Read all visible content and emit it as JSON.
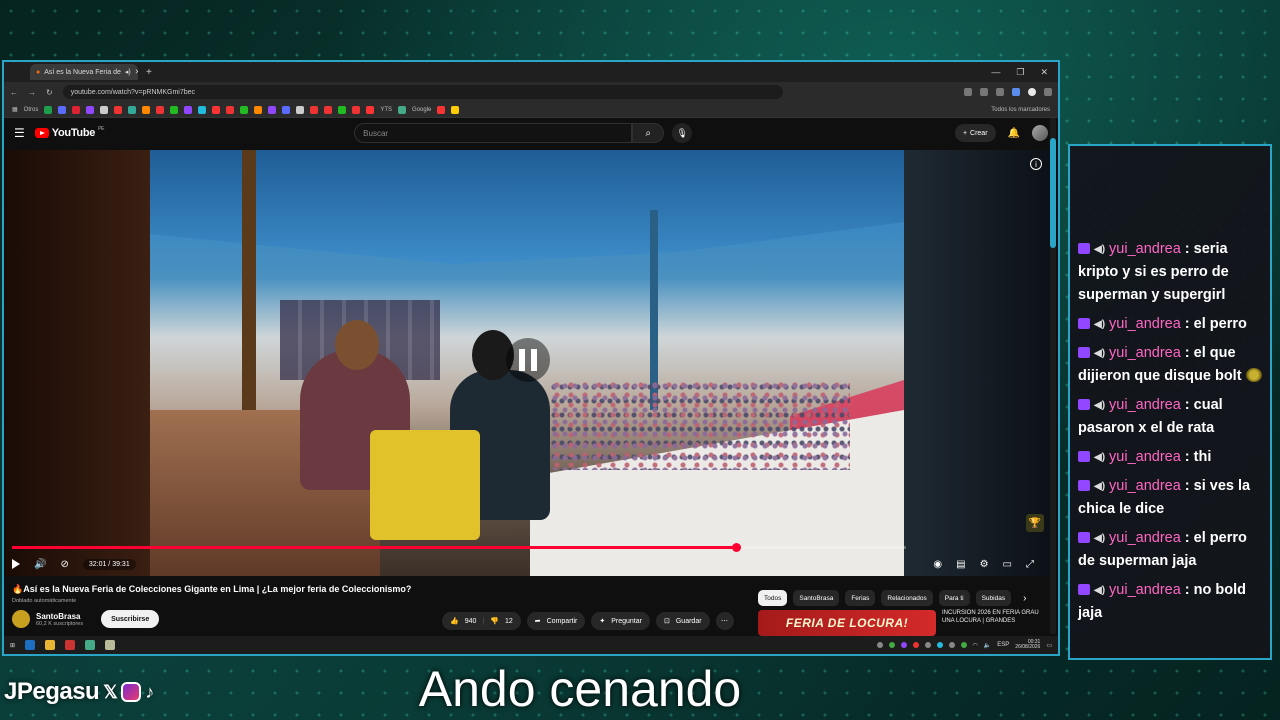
{
  "browser": {
    "tab_title": "Así es la Nueva Feria de",
    "url": "youtube.com/watch?v=pRNMKGmi7bec",
    "bookmarks": {
      "others": "Otros",
      "yts": "YTS",
      "google": "Google",
      "all": "Todos los marcadores"
    }
  },
  "youtube": {
    "logo": "YouTube",
    "region": "PE",
    "search_placeholder": "Buscar",
    "create_label": "Crear"
  },
  "player": {
    "time": "32:01 / 39:31",
    "progress_fraction": 0.81
  },
  "video": {
    "title": "🔥Así es la Nueva Feria de Colecciones Gigante en Lima | ¿La mejor feria de Coleccionismo?",
    "dubbed": "Doblado automáticamente",
    "channel": "SantoBrasa",
    "subscribers": "60,2 K suscriptores",
    "subscribe_label": "Suscribirse",
    "likes": "940",
    "dislikes": "12",
    "share_label": "Compartir",
    "ask_label": "Preguntar",
    "save_label": "Guardar"
  },
  "chips": [
    "Todos",
    "SantoBrasa",
    "Ferias",
    "Relacionados",
    "Para ti",
    "Subidas"
  ],
  "recommendation": {
    "thumb_text": "FERIA DE LOCURA!",
    "title": "INCURSION 2026 EN FERIA GRAU UNA LOCURA | GRANDES"
  },
  "taskbar": {
    "lang": "ESP",
    "time": "00:31",
    "date": "26/08/2026"
  },
  "chat": {
    "messages": [
      {
        "user": "yui_andrea",
        "text": "seria kripto y si es perro de superman y supergirl"
      },
      {
        "user": "yui_andrea",
        "text": "el perro"
      },
      {
        "user": "yui_andrea",
        "text": "el que dijieron que disque bolt"
      },
      {
        "user": "yui_andrea",
        "text": "cual pasaron x el de rata"
      },
      {
        "user": "yui_andrea",
        "text": "thi"
      },
      {
        "user": "yui_andrea",
        "text": "si ves la chica le dice"
      },
      {
        "user": "yui_andrea",
        "text": "el perro de superman jaja"
      },
      {
        "user": "yui_andrea",
        "text": "no bold jaja"
      }
    ]
  },
  "overlay": {
    "handle": "JPegasu",
    "caption": "Ando cenando"
  },
  "colors": {
    "accent_border": "#2aa5c8",
    "chat_username": "#ff66c4",
    "progress": "#ff0033",
    "twitch": "#9146ff"
  }
}
